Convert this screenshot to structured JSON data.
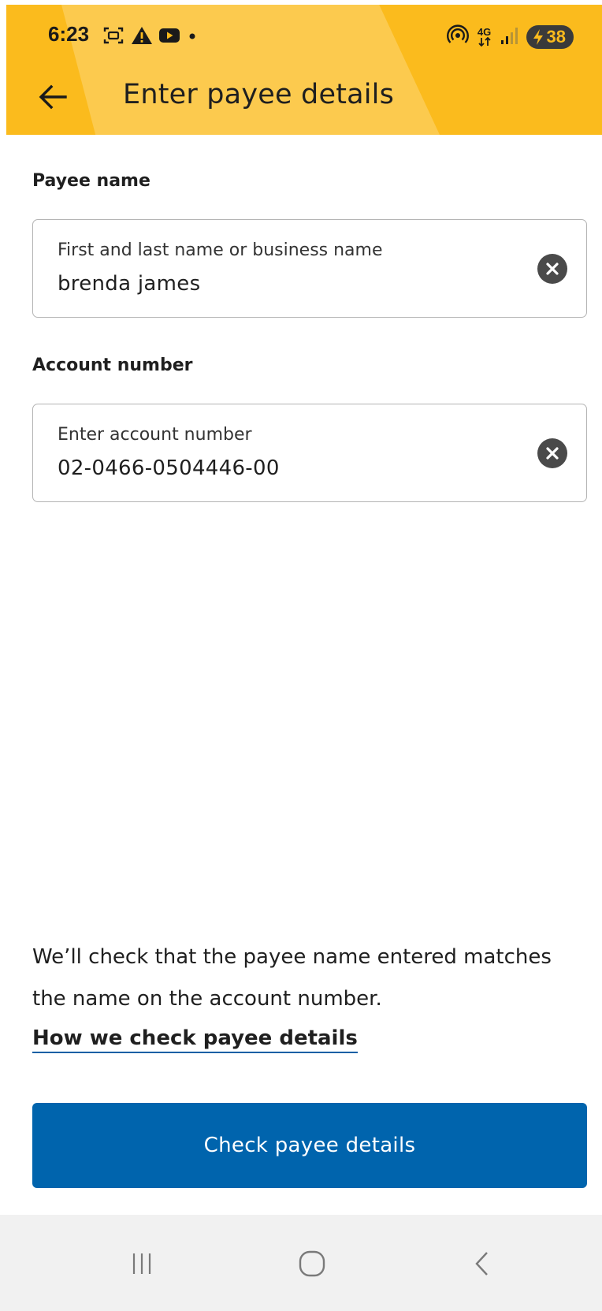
{
  "status_bar": {
    "time": "6:23",
    "network": "4G",
    "battery": "38",
    "icons": [
      "screenshot-icon",
      "warning-icon",
      "youtube-icon",
      "dot-icon",
      "hotspot-icon",
      "signal-icon",
      "battery-charging-icon"
    ]
  },
  "header": {
    "title": "Enter payee details",
    "back_icon": "arrow-left-icon"
  },
  "form": {
    "payee_name": {
      "label": "Payee name",
      "placeholder": "First and last name or business name",
      "value": "brenda james"
    },
    "account_number": {
      "label": "Account number",
      "placeholder": "Enter account number",
      "value": "02-0466-0504446-00"
    }
  },
  "info_text": "We’ll check that the payee name entered matches the name on the account number.",
  "help_link": "How we check payee details",
  "primary_button": "Check payee details",
  "colors": {
    "header": "#fbbb1d",
    "primary": "#0064ad",
    "link_underline": "#0b5fa5"
  },
  "nav_bar": {
    "icons": [
      "recent-apps-icon",
      "home-icon",
      "back-icon"
    ]
  }
}
